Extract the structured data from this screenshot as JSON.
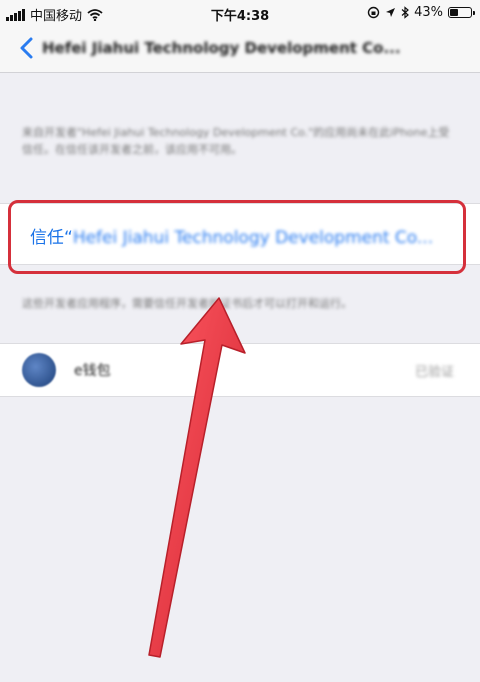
{
  "status_bar": {
    "carrier": "中国移动",
    "time": "下午4:38",
    "battery_percent": "43%",
    "battery_level": 0.43
  },
  "nav": {
    "title": "Hefei Jiahui Technology Development Co..."
  },
  "description": "来自开发者\"Hefei Jiahui Technology Development Co.\"的应用尚未在此iPhone上受信任。在信任该开发者之前，该应用不可用。",
  "trust": {
    "prefix": "信任“",
    "developer": "Hefei Jiahui Technology Development Co..."
  },
  "note": "这些开发者应用程序，需要信任开发者的证书后才可以打开和运行。",
  "app": {
    "name": "e钱包",
    "status": "已验证"
  },
  "colors": {
    "link_blue": "#1a73e8",
    "highlight_red": "#d5303b",
    "arrow_red": "#e0303c",
    "background": "#efeff4"
  }
}
